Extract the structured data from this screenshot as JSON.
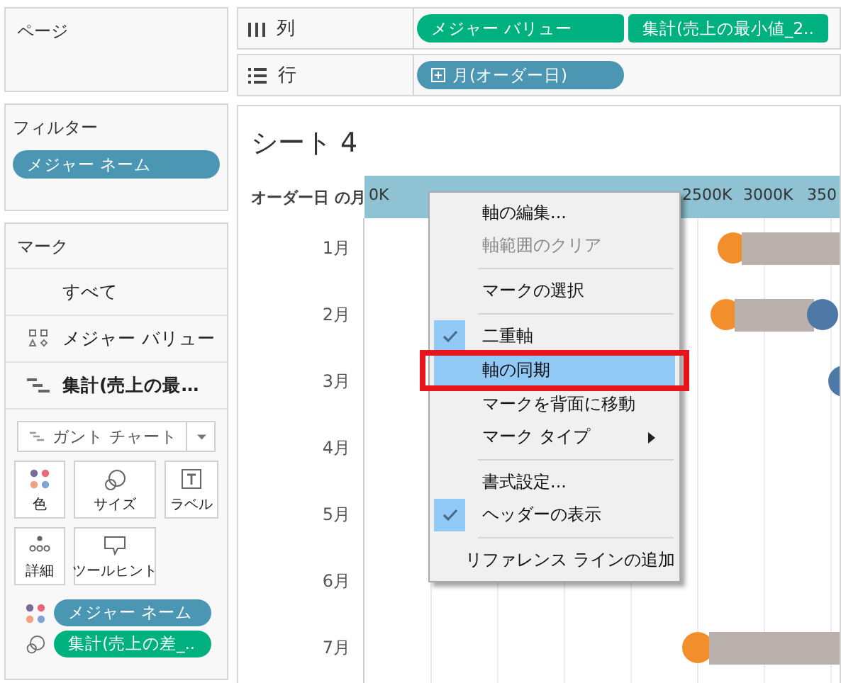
{
  "pages_card": {
    "title": "ページ"
  },
  "filters_card": {
    "title": "フィルター",
    "pills": [
      {
        "label": "メジャー ネーム",
        "color": "#4a96b3"
      }
    ]
  },
  "marks_card": {
    "title": "マーク",
    "layers": [
      {
        "label": "すべて",
        "kind": "all",
        "bold": false
      },
      {
        "label": "メジャー バリュー",
        "kind": "shapes",
        "bold": false
      },
      {
        "label": "集計(売上の最…",
        "kind": "gantt",
        "bold": true
      }
    ],
    "mark_type": "ガント チャート",
    "buttons": [
      {
        "label": "色",
        "kind": "color"
      },
      {
        "label": "サイズ",
        "kind": "size"
      },
      {
        "label": "ラベル",
        "kind": "label"
      },
      {
        "label": "詳細",
        "kind": "detail"
      },
      {
        "label": "ツールヒント",
        "kind": "tooltip"
      }
    ],
    "pills": [
      {
        "label": "メジャー ネーム",
        "kind": "color",
        "color": "#4a96b3"
      },
      {
        "label": "集計(売上の差_..",
        "kind": "size",
        "color": "#00b180"
      }
    ]
  },
  "shelves": [
    {
      "label": "列",
      "kind": "columns",
      "pills": [
        {
          "label": "メジャー バリュー",
          "color": "#00b180",
          "expand": false
        },
        {
          "label": "集計(売上の最小値_2..",
          "color": "#00b180",
          "expand": false
        }
      ]
    },
    {
      "label": "行",
      "kind": "rows",
      "pills": [
        {
          "label": "月(オーダー日)",
          "color": "#4a96b3",
          "expand": true
        }
      ]
    }
  ],
  "sheet": {
    "title": "シート 4",
    "row_header": "オーダー日 の月",
    "axis_ticks": [
      "0K",
      "2500K",
      "3000K",
      "350"
    ],
    "rows": [
      "1月",
      "2月",
      "3月",
      "4月",
      "5月",
      "6月",
      "7月"
    ]
  },
  "context_menu": {
    "items": [
      {
        "kind": "item",
        "label": "軸の編集...",
        "disabled": false,
        "checked": false,
        "selected": false,
        "submenu": false,
        "framed": false
      },
      {
        "kind": "item",
        "label": "軸範囲のクリア",
        "disabled": true,
        "checked": false,
        "selected": false,
        "submenu": false,
        "framed": false
      },
      {
        "kind": "separator"
      },
      {
        "kind": "item",
        "label": "マークの選択",
        "disabled": false,
        "checked": false,
        "selected": false,
        "submenu": false,
        "framed": false
      },
      {
        "kind": "separator"
      },
      {
        "kind": "item",
        "label": "二重軸",
        "disabled": false,
        "checked": true,
        "selected": false,
        "submenu": false,
        "framed": false
      },
      {
        "kind": "item",
        "label": "軸の同期",
        "disabled": false,
        "checked": false,
        "selected": true,
        "submenu": false,
        "framed": true
      },
      {
        "kind": "item",
        "label": "マークを背面に移動",
        "disabled": false,
        "checked": false,
        "selected": false,
        "submenu": false,
        "framed": false
      },
      {
        "kind": "item",
        "label": "マーク タイプ",
        "disabled": false,
        "checked": false,
        "selected": false,
        "submenu": true,
        "framed": false
      },
      {
        "kind": "separator"
      },
      {
        "kind": "item",
        "label": "書式設定...",
        "disabled": false,
        "checked": false,
        "selected": false,
        "submenu": false,
        "framed": false
      },
      {
        "kind": "item",
        "label": "ヘッダーの表示",
        "disabled": false,
        "checked": true,
        "selected": false,
        "submenu": false,
        "framed": false
      },
      {
        "kind": "separator"
      },
      {
        "kind": "item",
        "label": "リファレンス ラインの追加",
        "disabled": false,
        "checked": false,
        "selected": false,
        "submenu": false,
        "framed": false
      }
    ]
  }
}
